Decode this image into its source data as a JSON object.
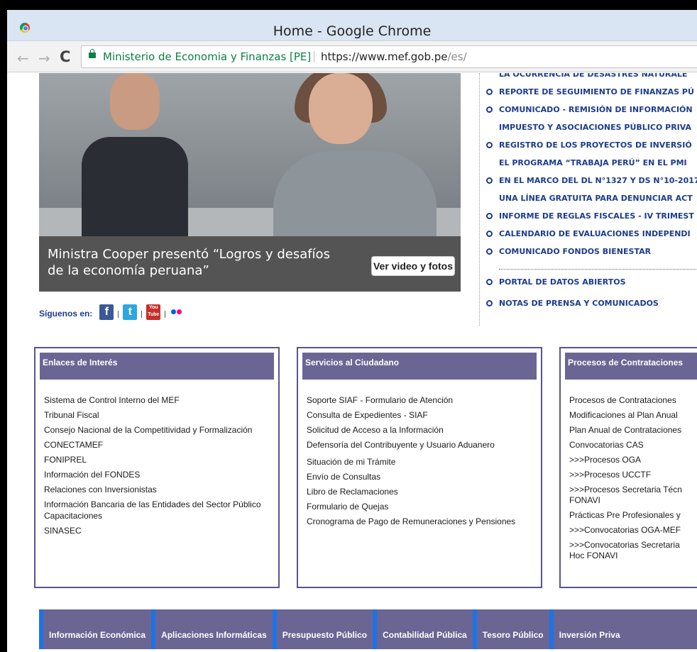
{
  "window": {
    "title": "Home - Google Chrome",
    "site_identity": "Ministerio de Economia y Finanzas [PE]",
    "url_host": "https://www.mef.gob.pe",
    "url_path": "/es/"
  },
  "hero": {
    "caption": "Ministra Cooper presentó “Logros y desafíos de la economía peruana”",
    "button": "Ver video y fotos"
  },
  "social": {
    "label": "Síguenos en:",
    "icons": [
      "facebook-icon",
      "twitter-icon",
      "youtube-icon",
      "flickr-icon"
    ],
    "youtube_text": "You Tube"
  },
  "news": {
    "top_partial": "LA OCURRENCIA DE DESASTRES NATURALE",
    "items": [
      {
        "label": "REPORTE DE SEGUIMIENTO DE FINANZAS PÚ",
        "cont": ""
      },
      {
        "label": "COMUNICADO - REMISIÓN DE INFORMACIÓN",
        "cont": "IMPUESTO Y ASOCIACIONES PÚBLICO PRIVA"
      },
      {
        "label": "REGISTRO DE LOS PROYECTOS DE INVERSIÓ",
        "cont": "EL PROGRAMA “TRABAJA PERÚ” EN EL PMI"
      },
      {
        "label": "EN EL MARCO DEL DL N°1327 Y DS N°10-2017",
        "cont": "UNA LÍNEA GRATUITA PARA DENUNCIAR ACT"
      },
      {
        "label": "INFORME DE REGLAS FISCALES - IV TRIMEST",
        "cont": ""
      },
      {
        "label": "CALENDARIO DE EVALUACIONES INDEPENDI",
        "cont": ""
      },
      {
        "label": "COMUNICADO FONDOS BIENESTAR",
        "cont": ""
      }
    ],
    "after_dots": [
      "PORTAL DE DATOS ABIERTOS",
      "NOTAS DE PRENSA Y COMUNICADOS"
    ]
  },
  "boxes": {
    "enlaces": {
      "title": "Enlaces de Interés",
      "links": [
        "Sistema de Control Interno del MEF",
        "Tribunal Fiscal",
        "Consejo Nacional de la Competitividad y Formalización",
        "CONECTAMEF",
        "FONIPREL",
        "Información del FONDES",
        "Relaciones con Inversionistas",
        "Información Bancaria de las Entidades del Sector Público",
        "Capacitaciones",
        "SINASEC"
      ]
    },
    "servicios": {
      "title": "Servicios al Ciudadano",
      "links": [
        "Soporte SIAF - Formulario de Atención",
        "Consulta de Expedientes - SIAF",
        "Solicitud de Acceso a la Información",
        "Defensoría del Contribuyente y Usuario Aduanero",
        "Situación de mi Trámite",
        "Envío de Consultas",
        "Libro de Reclamaciones",
        "Formulario de Quejas",
        "Cronograma de Pago de Remuneraciones y Pensiones"
      ]
    },
    "procesos": {
      "title": "Procesos de Contrataciones",
      "links": [
        "Procesos de Contrataciones",
        "Modificaciones al Plan Anual",
        "Plan Anual de Contrataciones",
        "Convocatorias CAS",
        ">>>Procesos OGA",
        ">>>Procesos UCCTF",
        ">>>Procesos Secretaria Técn",
        "FONAVI",
        "Prácticas Pre Profesionales y",
        ">>>Convocatorias OGA-MEF",
        ">>>Convocatorias Secretaria",
        "Hoc FONAVI"
      ]
    }
  },
  "bottom_nav": [
    "Información Económica",
    "Aplicaciones Informáticas",
    "Presupuesto Público",
    "Contabilidad Pública",
    "Tesoro Público",
    "Inversión Priva"
  ]
}
